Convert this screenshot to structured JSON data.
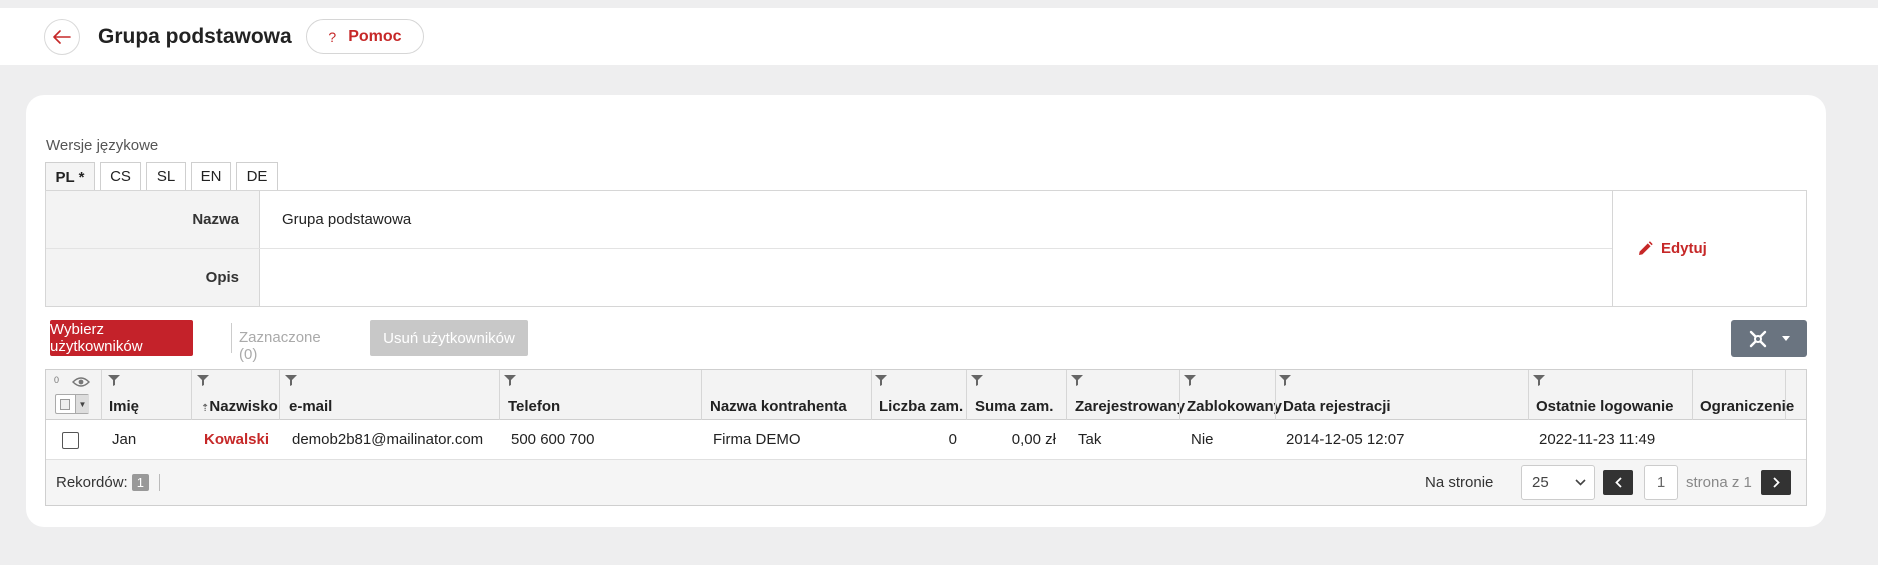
{
  "header": {
    "title": "Grupa podstawowa",
    "help_label": "Pomoc",
    "help_glyph": "?"
  },
  "languages": {
    "label": "Wersje językowe",
    "tabs": [
      "PL *",
      "CS",
      "SL",
      "EN",
      "DE"
    ],
    "active": "PL *"
  },
  "form": {
    "name_label": "Nazwa",
    "name_value": "Grupa podstawowa",
    "description_label": "Opis",
    "description_value": "",
    "edit_label": "Edytuj"
  },
  "toolbar": {
    "select_users_label": "Wybierz użytkowników",
    "selected_label": "Zaznaczone (0)",
    "remove_users_label": "Usuń użytkowników"
  },
  "grid": {
    "hidden_count": "0",
    "columns": [
      "Imię",
      "Nazwisko",
      "e-mail",
      "Telefon",
      "Nazwa kontrahenta",
      "Liczba zam.",
      "Suma zam.",
      "Zarejestrowany",
      "Zablokowany",
      "Data rejestracji",
      "Ostatnie logowanie",
      "Ograniczenie"
    ],
    "rows": [
      {
        "first_name": "Jan",
        "last_name": "Kowalski",
        "email": "demob2b81@mailinator.com",
        "phone": "500 600 700",
        "company": "Firma DEMO",
        "orders_count": "0",
        "orders_sum": "0,00 zł",
        "registered": "Tak",
        "blocked": "Nie",
        "registration_date": "2014-12-05 12:07",
        "last_login": "2022-11-23 11:49",
        "limit": ""
      }
    ],
    "footer": {
      "records_label": "Rekordów:",
      "records_count": "1",
      "per_page_label": "Na stronie",
      "per_page_value": "25",
      "page_value": "1",
      "page_of_label": "strona z 1"
    }
  },
  "colors": {
    "accent": "#c4222a",
    "link": "#c62828",
    "tools_button": "#6a7480"
  }
}
